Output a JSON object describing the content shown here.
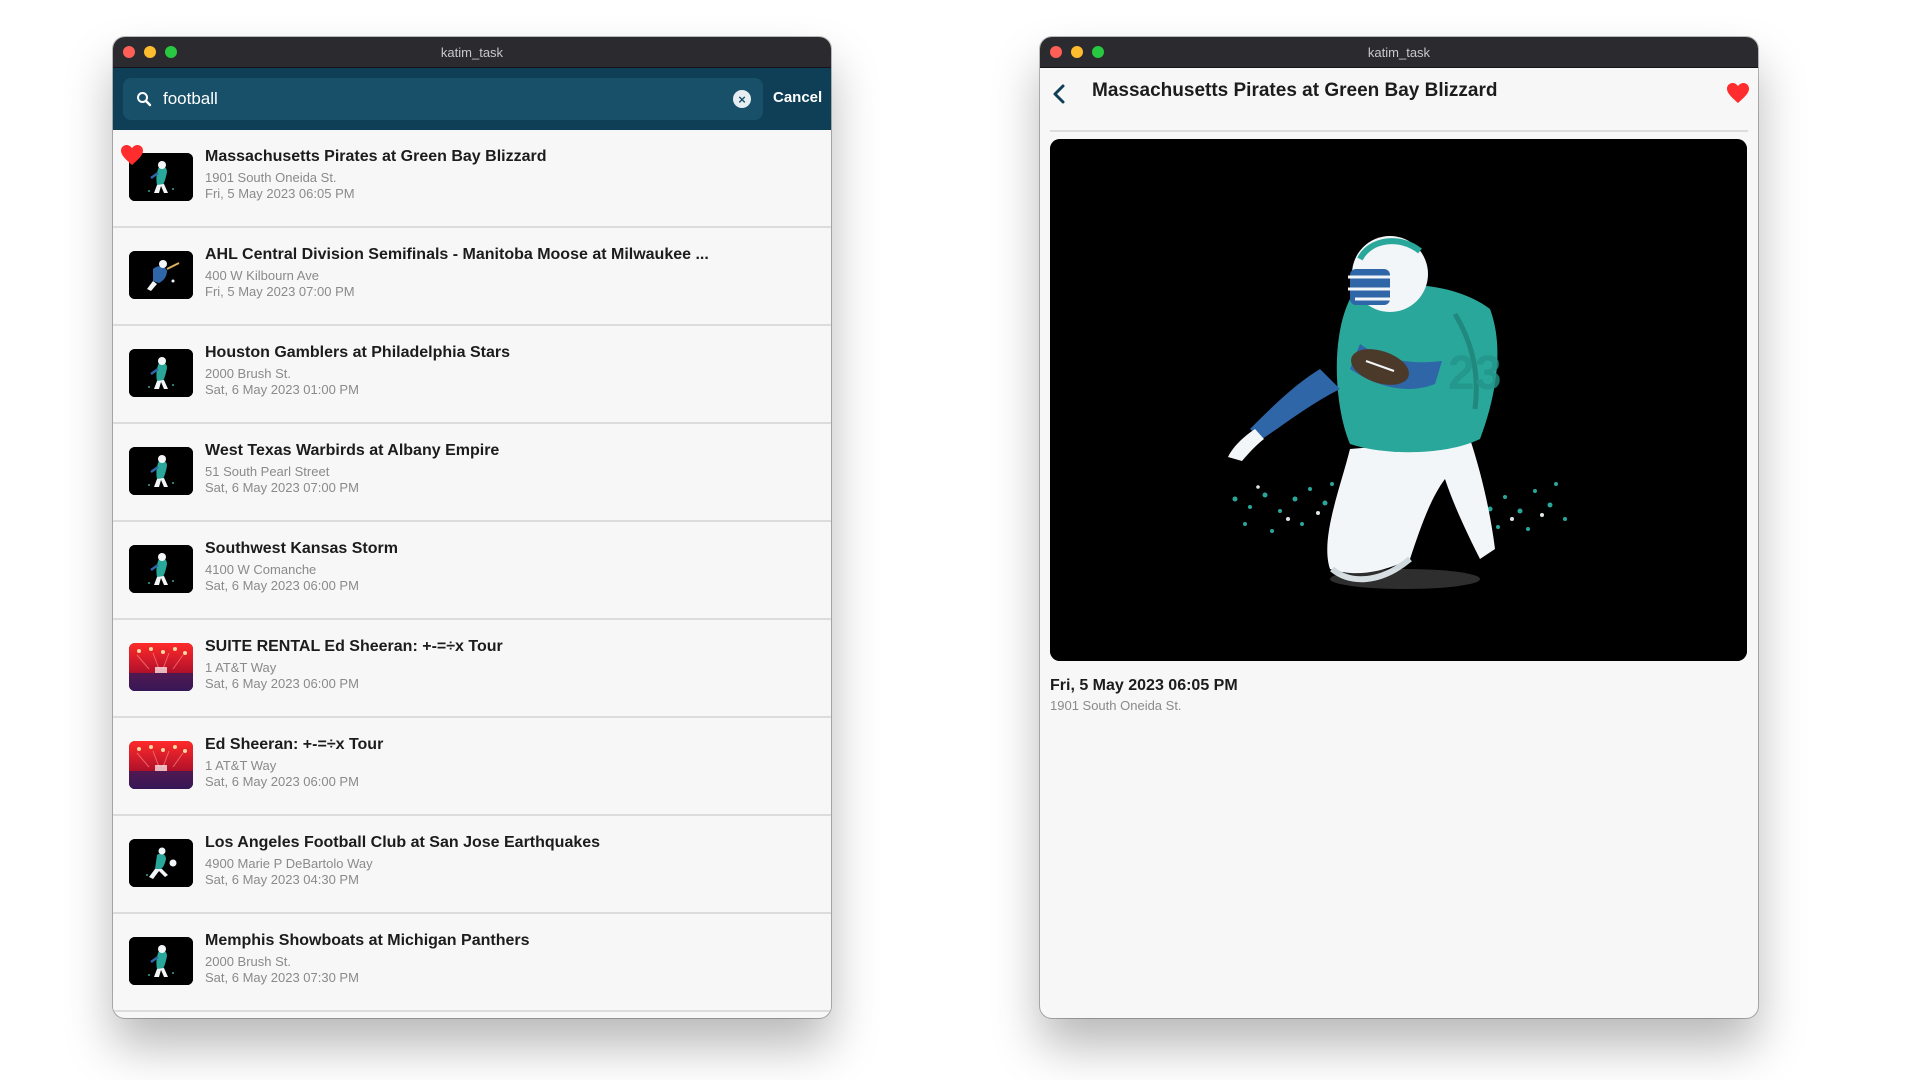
{
  "app": {
    "window_title": "katim_task"
  },
  "search": {
    "query": "football",
    "placeholder": "",
    "cancel_label": "Cancel"
  },
  "events": [
    {
      "title": "Massachusetts Pirates at Green Bay Blizzard",
      "address": "1901 South Oneida St.",
      "date": "Fri, 5 May 2023 06:05 PM",
      "thumb": "football",
      "favorite": true
    },
    {
      "title": "AHL Central Division Semifinals - Manitoba Moose at Milwaukee ...",
      "address": "400 W Kilbourn Ave",
      "date": "Fri, 5 May 2023 07:00 PM",
      "thumb": "hockey",
      "favorite": false
    },
    {
      "title": "Houston Gamblers at Philadelphia Stars",
      "address": "2000 Brush St.",
      "date": "Sat, 6 May 2023 01:00 PM",
      "thumb": "football",
      "favorite": false
    },
    {
      "title": "West Texas Warbirds at Albany Empire",
      "address": "51 South Pearl Street",
      "date": "Sat, 6 May 2023 07:00 PM",
      "thumb": "football",
      "favorite": false
    },
    {
      "title": "Southwest Kansas Storm",
      "address": "4100 W Comanche",
      "date": "Sat, 6 May 2023 06:00 PM",
      "thumb": "football",
      "favorite": false
    },
    {
      "title": "SUITE RENTAL Ed Sheeran: +-=÷x Tour",
      "address": "1 AT&T Way",
      "date": "Sat, 6 May 2023 06:00 PM",
      "thumb": "concert",
      "favorite": false
    },
    {
      "title": "Ed Sheeran: +-=÷x Tour",
      "address": "1 AT&T Way",
      "date": "Sat, 6 May 2023 06:00 PM",
      "thumb": "concert",
      "favorite": false
    },
    {
      "title": "Los Angeles Football Club at San Jose Earthquakes",
      "address": "4900 Marie P DeBartolo Way",
      "date": "Sat, 6 May 2023 04:30 PM",
      "thumb": "soccer",
      "favorite": false
    },
    {
      "title": "Memphis Showboats at Michigan Panthers",
      "address": "2000 Brush St.",
      "date": "Sat, 6 May 2023 07:30 PM",
      "thumb": "football",
      "favorite": false
    }
  ],
  "detail": {
    "title": "Massachusetts Pirates at Green Bay Blizzard",
    "date": "Fri, 5 May 2023 06:05 PM",
    "address": "1901 South Oneida St.",
    "favorite": true,
    "image": "football-player-illustration"
  },
  "colors": {
    "search_bar": "#0e3f56",
    "heart": "#ff2d2d",
    "accent": "#0e3f56"
  },
  "icons": [
    "search-icon",
    "clear-icon",
    "heart-icon",
    "back-icon"
  ]
}
